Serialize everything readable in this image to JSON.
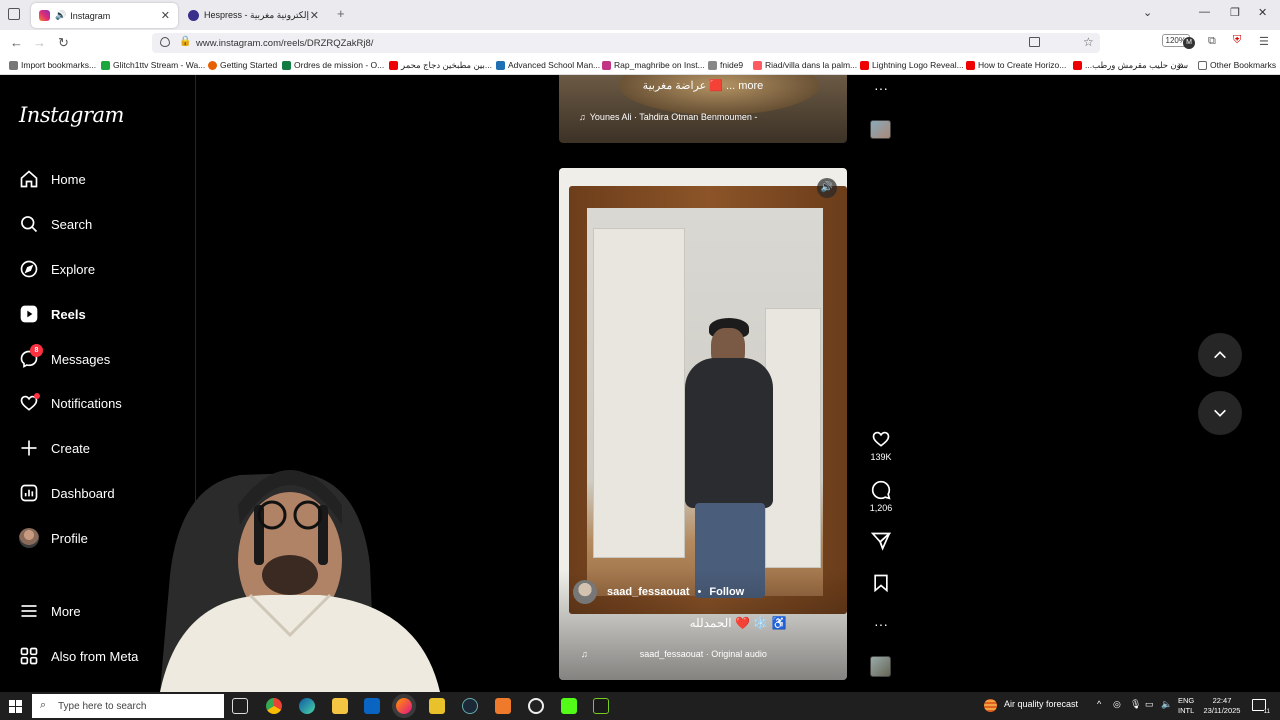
{
  "browser": {
    "tabs": [
      {
        "title": "Instagram",
        "active": true
      },
      {
        "title": "Hespress - جريدة إلكترونية مغربية",
        "active": false
      }
    ],
    "new_tab": "+",
    "url": "www.instagram.com/reels/DRZRQZakRj8/",
    "zoom": "120%",
    "bookmarks": [
      "Import bookmarks...",
      "Glitch1ttv Stream - Wa...",
      "Getting Started",
      "Ordres de mission - O...",
      "بين مطبخين دجاج محمر...",
      "Advanced School Man...",
      "Rap_maghribe on Inst...",
      "fnide9",
      "Riad/villa dans la palm...",
      "Lightning Logo Reveal...",
      "How to Create Horizo...",
      "...سون حليب مقرمش ورطب",
      "Other Bookmarks"
    ]
  },
  "sidebar": {
    "logo": "Instagram",
    "items": [
      {
        "label": "Home",
        "icon": "home-icon"
      },
      {
        "label": "Search",
        "icon": "search-icon"
      },
      {
        "label": "Explore",
        "icon": "compass-icon"
      },
      {
        "label": "Reels",
        "icon": "reels-icon"
      },
      {
        "label": "Messages",
        "icon": "messenger-icon",
        "badge": "8"
      },
      {
        "label": "Notifications",
        "icon": "heart-icon"
      },
      {
        "label": "Create",
        "icon": "plus-icon"
      },
      {
        "label": "Dashboard",
        "icon": "dashboard-icon"
      },
      {
        "label": "Profile",
        "icon": "avatar"
      }
    ],
    "more": "More",
    "also_from_meta": "Also from Meta"
  },
  "reel_prev": {
    "caption": "عراضة مغربية 🟥 ... more",
    "audio": "Younes Ali · Tahdira Otman Benmoumen -"
  },
  "reel": {
    "username": "saad_fessaouat",
    "separator": "•",
    "follow": "Follow",
    "caption": "الحمدلله ❤️ ❄️ ♿",
    "audio": "saad_fessaouat · Original audio",
    "likes": "139K",
    "comments": "1,206"
  },
  "taskbar": {
    "search_placeholder": "Type here to search",
    "weather": "Air quality forecast",
    "lang_top": "ENG",
    "lang_bottom": "INTL",
    "time": "22:47",
    "date": "23/11/2025",
    "notif_count": "11"
  },
  "colors": {
    "badge": "#ff3040",
    "bg": "#000000",
    "follow": "#ffffff"
  }
}
